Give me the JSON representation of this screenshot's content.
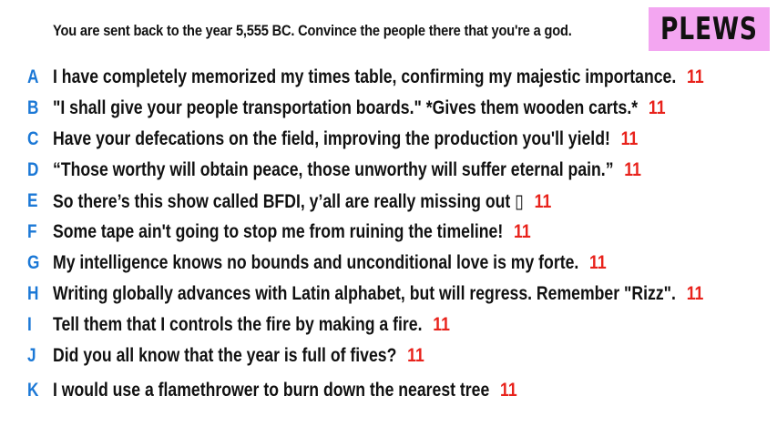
{
  "prompt": "You are sent back to the year 5,555 BC. Convince the people there that you're a god.",
  "brand": "PLEWS",
  "colors": {
    "letter": "#1b78d6",
    "score": "#e8221b",
    "brand_bg": "#f3a6f1"
  },
  "options": [
    {
      "letter": "A",
      "text": "I have completely memorized my times table, confirming my majestic importance.",
      "score": "11"
    },
    {
      "letter": "B",
      "text": "\"I shall give your people transportation boards.\" *Gives them wooden carts.*",
      "score": "11"
    },
    {
      "letter": "C",
      "text": "Have your defecations on the field, improving the production you'll yield!",
      "score": "11"
    },
    {
      "letter": "D",
      "text": "“Those worthy will obtain peace, those unworthy will suffer eternal pain.”",
      "score": "11"
    },
    {
      "letter": "E",
      "text": "So there’s this show called BFDI, y’all are really missing out ▯",
      "score": "11"
    },
    {
      "letter": "F",
      "text": "Some tape ain't going to stop me from ruining the timeline!",
      "score": "11"
    },
    {
      "letter": "G",
      "text": "My intelligence knows no bounds and unconditional love is my forte.",
      "score": "11"
    },
    {
      "letter": "H",
      "text": "Writing globally advances with Latin alphabet, but will regress. Remember \"Rizz\".",
      "score": "11"
    },
    {
      "letter": "I",
      "text": "Tell them that I controls the fire by making a fire.",
      "score": "11"
    },
    {
      "letter": "J",
      "text": "Did you all know that the year is full of fives?",
      "score": "11"
    },
    {
      "letter": "K",
      "text": "I would use a flamethrower to burn down the nearest tree",
      "score": "11"
    }
  ]
}
